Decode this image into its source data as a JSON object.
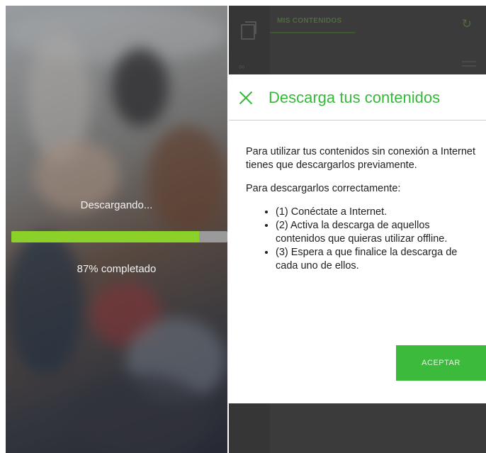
{
  "download": {
    "status_label": "Descargando...",
    "progress_fraction": 0.87,
    "progress_text": "87% completado"
  },
  "app": {
    "tab_label": "MIS CONTENIDOS",
    "small_glyph": "⁰⁰",
    "icons": [
      "copy-icon",
      "refresh-icon",
      "menu-icon"
    ]
  },
  "dialog": {
    "title": "Descarga tus contenidos",
    "paragraph1": "Para utilizar tus contenidos sin conexión a Internet tienes que descargarlos previamente.",
    "paragraph2": "Para descargarlos correctamente:",
    "steps": [
      "(1) Conéctate a Internet.",
      "(2) Activa la descarga de aquellos contenidos que quieras utilizar offline.",
      "(3) Espera a que finalice la descarga de cada uno de ellos."
    ],
    "accept_label": "ACEPTAR"
  },
  "colors": {
    "accent_green": "#36b93a",
    "progress_green": "#8bd12a",
    "button_green": "#3cba3c",
    "overlay_dark": "#3b3b3b"
  }
}
